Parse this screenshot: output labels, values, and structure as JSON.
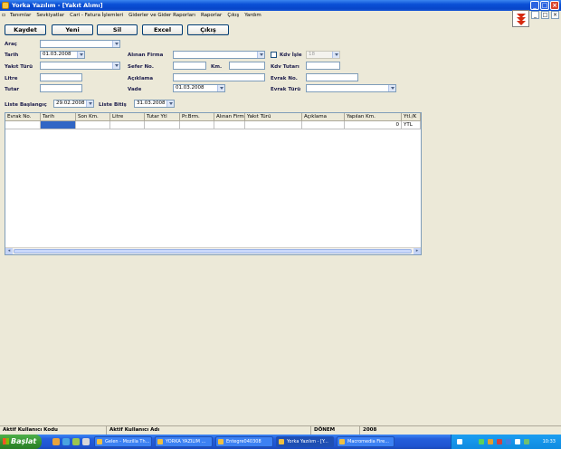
{
  "window": {
    "title": "Yorka Yazılım - [Yakıt Alımı]"
  },
  "menu": [
    "Tanımlar",
    "Sevkiyatlar",
    "Cari - Fatura İşlemleri",
    "Giderler ve Gider Raporları",
    "Raporlar",
    "Çıkış",
    "Yardım"
  ],
  "toolbar": {
    "save": "Kaydet",
    "new": "Yeni",
    "delete": "Sil",
    "excel": "Excel",
    "exit": "Çıkış"
  },
  "form": {
    "arac_label": "Araç",
    "tarih_label": "Tarih",
    "tarih_value": "01.03.2008",
    "yakit_turu_label": "Yakıt Türü",
    "litre_label": "Litre",
    "tutar_label": "Tutar",
    "alinan_firma_label": "Alınan Firma",
    "sefer_no_label": "Sefer No.",
    "km_label": "Km.",
    "aciklama_label": "Açıklama",
    "vade_label": "Vade",
    "vade_value": "01.03.2008",
    "kdv_isle_label": "Kdv İşle",
    "kdv_value": "18",
    "kdv_tutari_label": "Kdv Tutarı",
    "evrak_no_label": "Evrak No.",
    "evrak_turu_label": "Evrak Türü"
  },
  "list_filter": {
    "start_label": "Liste Başlangıç",
    "start_value": "29.02.2008",
    "end_label": "Liste Bitiş",
    "end_value": "31.03.2008"
  },
  "grid": {
    "columns": [
      "Evrak No.",
      "Tarih",
      "Son Km.",
      "Litre",
      "Tutar Ytl",
      "Pr.Brm.",
      "Alınan Firm",
      "Yakıt Türü",
      "Açıklama",
      "Yapılan Km.",
      "Ytl./K"
    ],
    "row": [
      "",
      "",
      "",
      "",
      "",
      "",
      "",
      "",
      "",
      "0",
      "YTL"
    ]
  },
  "statusbar": {
    "user_code_label": "Aktif Kullanıcı Kodu",
    "user_name_label": "Aktif Kullanıcı Adı",
    "period_label": "DÖNEM",
    "period_value": "2008"
  },
  "taskbar": {
    "start": "Başlat",
    "tasks": [
      "Gelen - Mozilla Th...",
      "YORKA YAZILIM ...",
      "Entegre040308",
      "Yorka Yazılım - [Y...",
      "Macromedia Fire..."
    ],
    "clock": "10:33"
  }
}
